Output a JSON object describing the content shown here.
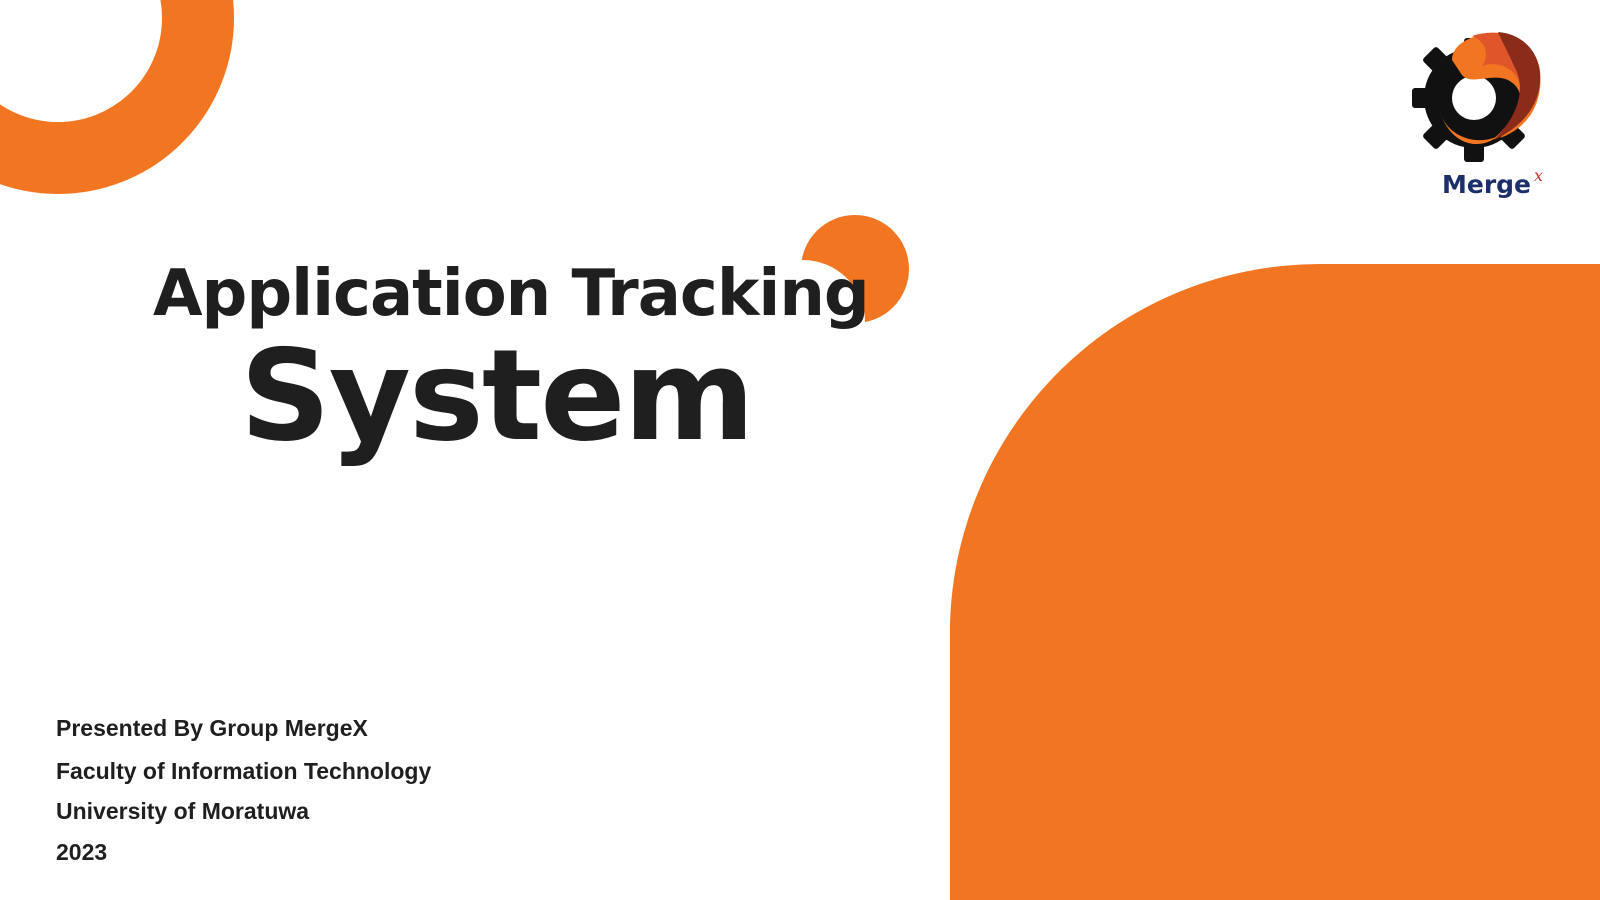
{
  "colors": {
    "accent": "#F27521",
    "text": "#1F1F1F",
    "logo_text": "#1C2F6B",
    "logo_gear": "#111111",
    "logo_dark_red": "#8B2B1A"
  },
  "title": {
    "line1": "Application Tracking",
    "line2": "System"
  },
  "presenter": {
    "group": "Presented By Group MergeX",
    "faculty": "Faculty of Information Technology",
    "university": "University of Moratuwa",
    "year": "2023"
  },
  "logo": {
    "icon": "gear-swirl-logo-icon",
    "text": "Merge",
    "superscript": "x"
  }
}
